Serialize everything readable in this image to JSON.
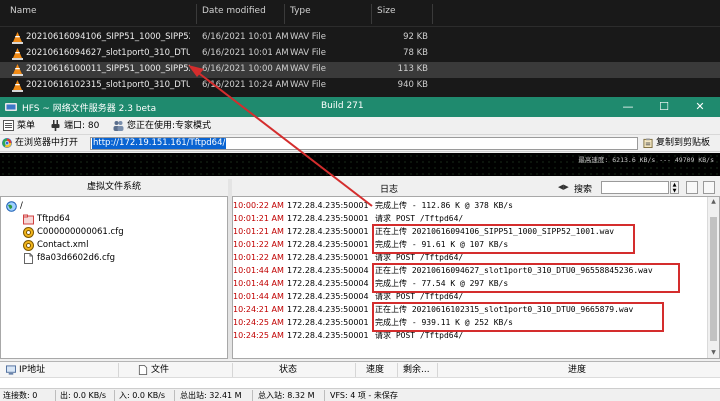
{
  "explorer": {
    "columns": {
      "name": "Name",
      "date": "Date modified",
      "type": "Type",
      "size": "Size"
    },
    "files": [
      {
        "name": "20210616094106_SIPP51_1000_SIPP52_1000...",
        "date": "6/16/2021 10:01 AM",
        "type": "WAV File",
        "size": "92 KB"
      },
      {
        "name": "20210616094627_slot1port0_310_DTU0_96...",
        "date": "6/16/2021 10:01 AM",
        "type": "WAV File",
        "size": "78 KB"
      },
      {
        "name": "20210616100011_SIPP51_1000_SIPP52_100...",
        "date": "6/16/2021 10:00 AM",
        "type": "WAV File",
        "size": "113 KB"
      },
      {
        "name": "20210616102315_slot1port0_310_DTU0_96...",
        "date": "6/16/2021 10:24 AM",
        "type": "WAV File",
        "size": "940 KB"
      }
    ]
  },
  "window": {
    "title": "HFS ~ 网络文件服务器 2.3 beta",
    "build": "Build 271",
    "minimize": "—",
    "maximize": "☐",
    "close": "✕"
  },
  "menu": {
    "menu_label": "菜单",
    "port_label": "端口: 80",
    "mode_label": "您正在使用:专家模式"
  },
  "urlbar": {
    "open_label": "在浏览器中打开",
    "url": "http://172.19.151.161/Tftpd64/",
    "copy_label": "复制到剪贴板"
  },
  "graph": {
    "speed": "最高速度: 6213.6 KB/s --- 49709 KB/s"
  },
  "vfs": {
    "header": "虚拟文件系统",
    "nodes": [
      {
        "label": "/",
        "icon": "globe-icon"
      },
      {
        "label": "Tftpd64",
        "icon": "folder-icon"
      },
      {
        "label": "C000000000061.cfg",
        "icon": "cfg-file-icon"
      },
      {
        "label": "Contact.xml",
        "icon": "xml-file-icon"
      },
      {
        "label": "f8a03d6602d6.cfg",
        "icon": "file-icon"
      }
    ]
  },
  "log": {
    "header": "日志",
    "search_label": "搜索",
    "rows": [
      {
        "time": "10:00:22 AM",
        "addr": "172.28.4.235:50001",
        "msg": "完成上传 - 112.86 K @ 378 KB/s"
      },
      {
        "time": "10:01:21 AM",
        "addr": "172.28.4.235:50001",
        "msg": "请求 POST /Tftpd64/"
      },
      {
        "time": "10:01:21 AM",
        "addr": "172.28.4.235:50001",
        "msg": "正在上传 20210616094106_SIPP51_1000_SIPP52_1001.wav"
      },
      {
        "time": "10:01:22 AM",
        "addr": "172.28.4.235:50001",
        "msg": "完成上传 - 91.61 K @ 107 KB/s"
      },
      {
        "time": "10:01:22 AM",
        "addr": "172.28.4.235:50001",
        "msg": "请求 POST /Tftpd64/"
      },
      {
        "time": "10:01:44 AM",
        "addr": "172.28.4.235:50004",
        "msg": "正在上传 20210616094627_slot1port0_310_DTU0_96558845236.wav"
      },
      {
        "time": "10:01:44 AM",
        "addr": "172.28.4.235:50004",
        "msg": "完成上传 - 77.54 K @ 297 KB/s"
      },
      {
        "time": "10:01:44 AM",
        "addr": "172.28.4.235:50004",
        "msg": "请求 POST /Tftpd64/"
      },
      {
        "time": "10:24:21 AM",
        "addr": "172.28.4.235:50001",
        "msg": "正在上传 20210616102315_slot1port0_310_DTU0_9665879.wav"
      },
      {
        "time": "10:24:25 AM",
        "addr": "172.28.4.235:50001",
        "msg": "完成上传 - 939.11 K @ 252 KB/s"
      },
      {
        "time": "10:24:25 AM",
        "addr": "172.28.4.235:50001",
        "msg": "请求 POST /Tftpd64/"
      }
    ]
  },
  "connections": {
    "columns": {
      "ip": "IP地址",
      "file": "文件",
      "status": "状态",
      "speed": "速度",
      "remaining": "剩余...",
      "progress": "进度"
    }
  },
  "status": {
    "connections": "连接数: 0",
    "out": "出: 0.0 KB/s",
    "in": "入: 0.0 KB/s",
    "total_out": "总出站: 32.41 M",
    "total_in": "总入站: 8.32 M",
    "vfs": "VFS: 4 项 - 未保存"
  },
  "colors": {
    "title_bar": "#1f8a6e",
    "log_time": "#c00000",
    "highlight": "#d42d2d"
  }
}
